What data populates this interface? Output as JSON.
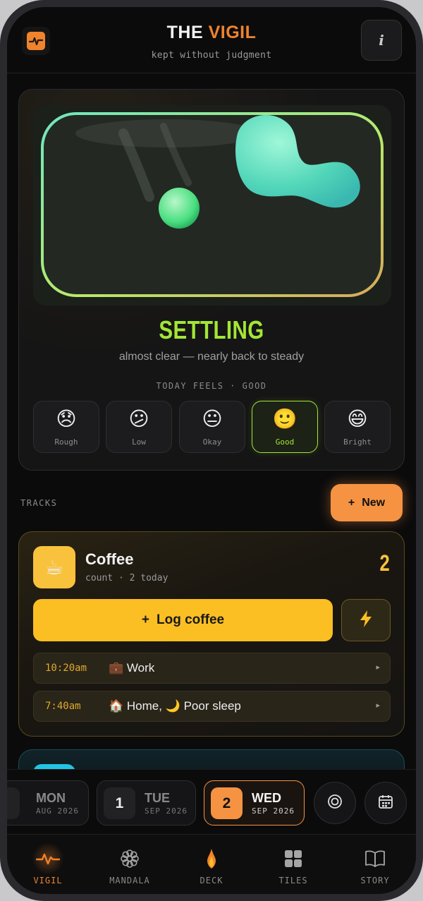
{
  "header": {
    "title_main": "THE ",
    "title_accent": "VIGIL",
    "subtitle": "kept without judgment",
    "info_label": "i"
  },
  "mood": {
    "status": "SETTLING",
    "description": "almost clear — nearly back to steady",
    "today_feels": "TODAY FEELS · GOOD",
    "options": [
      {
        "emoji": "😞",
        "label": "Rough",
        "selected": false
      },
      {
        "emoji": "😕",
        "label": "Low",
        "selected": false
      },
      {
        "emoji": "😐",
        "label": "Okay",
        "selected": false
      },
      {
        "emoji": "🙂",
        "label": "Good",
        "selected": true
      },
      {
        "emoji": "😄",
        "label": "Bright",
        "selected": false
      }
    ]
  },
  "tracks": {
    "section_label": "TRACKS",
    "new_plus": "+",
    "new_label": "New",
    "coffee": {
      "icon": "☕",
      "name": "Coffee",
      "meta": "count · 2 today",
      "count": "2",
      "log_plus": "+",
      "log_label": "Log coffee",
      "quick_icon": "⚡",
      "entries": [
        {
          "time": "10:20am",
          "tag": "💼 Work",
          "arrow": "▸"
        },
        {
          "time": "7:40am",
          "tag": "🏠 Home, 🌙 Poor sleep",
          "arrow": "▸"
        }
      ]
    }
  },
  "dates": [
    {
      "num": "",
      "name": "MON",
      "month": "AUG 2026",
      "selected": false
    },
    {
      "num": "1",
      "name": "TUE",
      "month": "SEP 2026",
      "selected": false
    },
    {
      "num": "2",
      "name": "WED",
      "month": "SEP 2026",
      "selected": true
    }
  ],
  "nav": [
    {
      "label": "VIGIL",
      "icon": "pulse-icon",
      "active": true
    },
    {
      "label": "MANDALA",
      "icon": "mandala-icon",
      "active": false
    },
    {
      "label": "DECK",
      "icon": "flame-icon",
      "active": false
    },
    {
      "label": "TILES",
      "icon": "tiles-icon",
      "active": false
    },
    {
      "label": "STORY",
      "icon": "book-icon",
      "active": false
    }
  ],
  "colors": {
    "accent": "#f0832b",
    "good": "#a3e635",
    "coffee": "#fbbf24"
  }
}
